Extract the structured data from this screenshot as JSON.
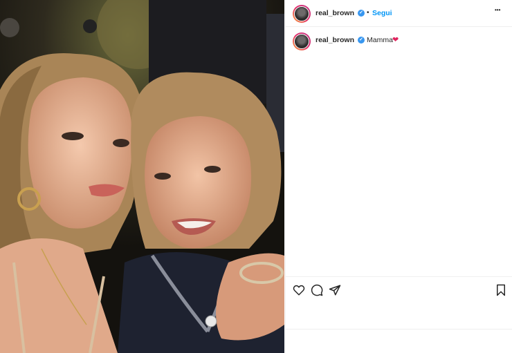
{
  "post": {
    "username": "real_brown",
    "follow_label": "Segui",
    "separator": "•",
    "more_label": "•••",
    "caption": "Mamma",
    "caption_emoji": "❤"
  },
  "icons": {
    "verified": "✓",
    "like": "heart-icon",
    "comment": "comment-icon",
    "share": "paper-plane-icon",
    "save": "bookmark-icon"
  },
  "colors": {
    "follow": "#0095f6",
    "verified": "#3897f0",
    "heart": "#e0245e"
  }
}
